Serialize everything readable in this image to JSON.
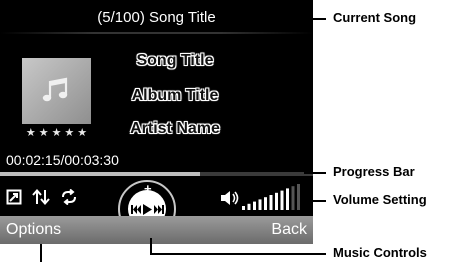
{
  "header": {
    "song": "(5/100) Song Title"
  },
  "track": {
    "title": "Song Title",
    "album": "Album Title",
    "artist": "Artist Name",
    "rating_stars": "★★★★★",
    "time": "00:02:15/00:03:30",
    "progress": 0.64
  },
  "volume": {
    "level_bars": 9,
    "total_bars": 11
  },
  "softkeys": {
    "left": "Options",
    "right": "Back"
  },
  "callouts": {
    "current_song": "Current Song",
    "progress_bar": "Progress Bar",
    "volume_setting": "Volume Setting",
    "music_controls": "Music Controls"
  },
  "icons": [
    "music-note-icon",
    "repeat-mode-icon",
    "shuffle-icon",
    "loop-icon",
    "speaker-icon",
    "play-icon",
    "previous-icon",
    "next-icon",
    "plus-icon",
    "minus-icon"
  ]
}
